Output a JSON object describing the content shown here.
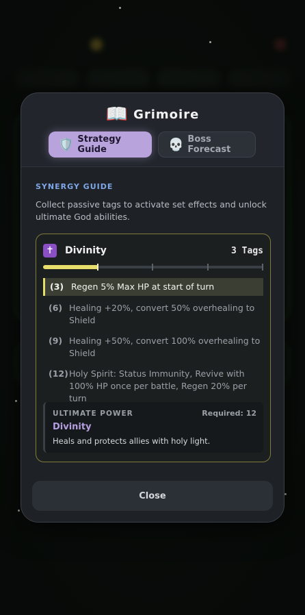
{
  "modal": {
    "title_icon": "📖",
    "title": "Grimoire",
    "tabs": [
      {
        "icon": "🛡️",
        "label": "Strategy Guide",
        "active": true
      },
      {
        "icon": "💀",
        "label": "Boss Forecast",
        "active": false
      }
    ],
    "section_label": "SYNERGY GUIDE",
    "description": "Collect passive tags to activate set effects and unlock ultimate God abilities.",
    "synergy": {
      "icon": "✝",
      "icon_color": "#8a4fc2",
      "name": "Divinity",
      "count_label": "3 Tags",
      "progress": {
        "current": 3,
        "max": 12,
        "thresholds": [
          3,
          6,
          9,
          12
        ]
      },
      "accent_color": "#e6dd6a",
      "tiers": [
        {
          "level": "(3)",
          "text": "Regen 5% Max HP at start of turn",
          "active": true
        },
        {
          "level": "(6)",
          "text": "Healing +20%, convert 50% overhealing to Shield",
          "active": false
        },
        {
          "level": "(9)",
          "text": "Healing +50%, convert 100% overhealing to Shield",
          "active": false
        },
        {
          "level": "(12)",
          "text": "Holy Spirit: Status Immunity, Revive with 100% HP once per battle, Regen 20% per turn",
          "active": false
        }
      ],
      "ultimate": {
        "label": "ULTIMATE POWER",
        "required": "Required: 12",
        "name": "Divinity",
        "description": "Heals and protects allies with holy light."
      }
    },
    "close_label": "Close"
  }
}
